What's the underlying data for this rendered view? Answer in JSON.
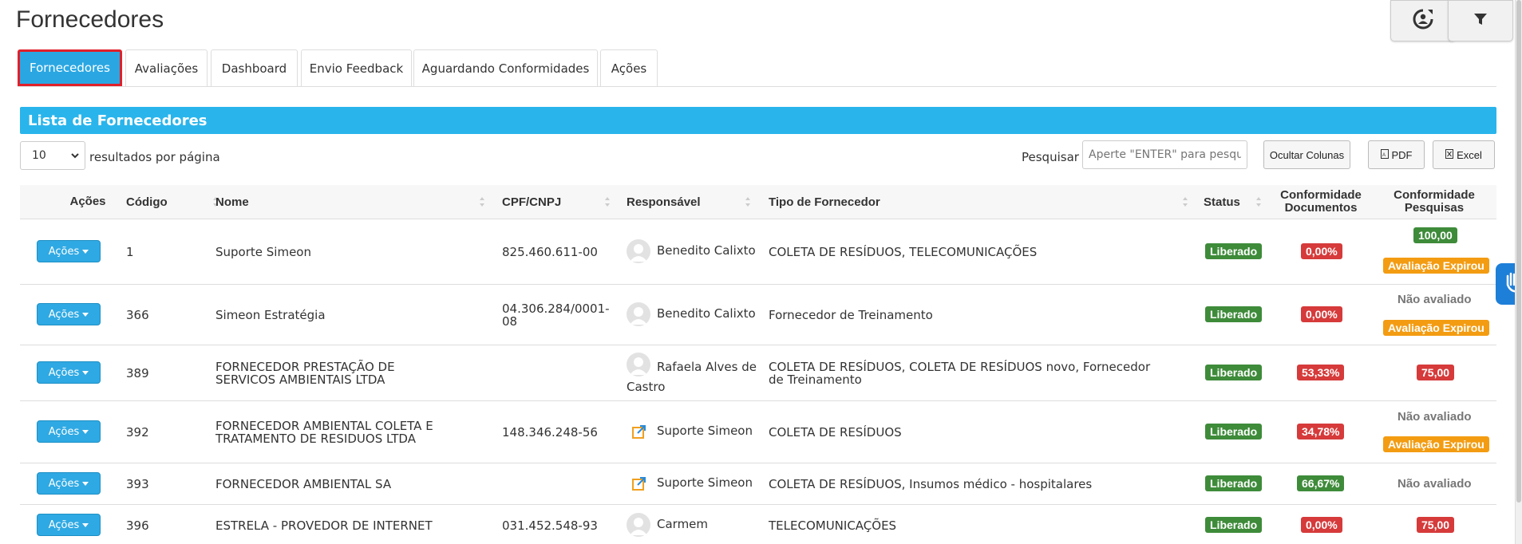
{
  "page": {
    "title": "Fornecedores"
  },
  "tabs": [
    {
      "label": "Fornecedores"
    },
    {
      "label": "Avaliações"
    },
    {
      "label": "Dashboard"
    },
    {
      "label": "Envio Feedback"
    },
    {
      "label": "Aguardando Conformidades"
    },
    {
      "label": "Ações"
    }
  ],
  "panel": {
    "title": "Lista de Fornecedores"
  },
  "controls": {
    "page_size": "10",
    "per_page_label": "resultados por página",
    "search_label": "Pesquisar",
    "search_placeholder": "Aperte \"ENTER\" para pesquisar",
    "hide_columns": "Ocultar Colunas",
    "pdf": "PDF",
    "excel": "Excel"
  },
  "table": {
    "headers": {
      "acoes": "Ações",
      "codigo": "Código",
      "nome": "Nome",
      "cpf": "CPF/CNPJ",
      "responsavel": "Responsável",
      "tipo": "Tipo de Fornecedor",
      "status": "Status",
      "conf_doc_1": "Conformidade",
      "conf_doc_2": "Documentos",
      "conf_pes_1": "Conformidade",
      "conf_pes_2": "Pesquisas"
    },
    "action_label": "Ações",
    "rows": [
      {
        "codigo": "1",
        "nome": "Suporte Simeon",
        "cpf": "825.460.611-00",
        "responsavel": "Benedito Calixto",
        "tipo": "COLETA DE RESÍDUOS, TELECOMUNICAÇÕES",
        "status": "Liberado",
        "conf_doc": "0,00%",
        "conf_pes_value": "100,00",
        "conf_pes_note": "Avaliação Expirou"
      },
      {
        "codigo": "366",
        "nome": "Simeon Estratégia",
        "cpf": "04.306.284/0001-08",
        "responsavel": "Benedito Calixto",
        "tipo": "Fornecedor de Treinamento",
        "status": "Liberado",
        "conf_doc": "0,00%",
        "conf_pes_text": "Não avaliado",
        "conf_pes_note": "Avaliação Expirou"
      },
      {
        "codigo": "389",
        "nome": "FORNECEDOR PRESTAÇÃO DE SERVICOS AMBIENTAIS LTDA",
        "cpf": "",
        "responsavel": "Rafaela Alves de Castro",
        "tipo": "COLETA DE RESÍDUOS, COLETA DE RESÍDUOS novo, Fornecedor de Treinamento",
        "status": "Liberado",
        "conf_doc": "53,33%",
        "conf_pes_value": "75,00"
      },
      {
        "codigo": "392",
        "nome": "FORNECEDOR AMBIENTAL COLETA E TRATAMENTO DE RESIDUOS LTDA",
        "cpf": "148.346.248-56",
        "responsavel": "Suporte Simeon",
        "tipo": "COLETA DE RESÍDUOS",
        "status": "Liberado",
        "conf_doc": "34,78%",
        "conf_pes_text": "Não avaliado",
        "conf_pes_note": "Avaliação Expirou"
      },
      {
        "codigo": "393",
        "nome": "FORNECEDOR AMBIENTAL SA",
        "cpf": "",
        "responsavel": "Suporte Simeon",
        "tipo": "COLETA DE RESÍDUOS, Insumos médico - hospitalares",
        "status": "Liberado",
        "conf_doc": "66,67%",
        "conf_pes_text": "Não avaliado"
      },
      {
        "codigo": "396",
        "nome": "ESTRELA - PROVEDOR DE INTERNET",
        "cpf": "031.452.548-93",
        "responsavel": "Carmem",
        "tipo": "TELECOMUNICAÇÕES",
        "status": "Liberado",
        "conf_doc": "0,00%",
        "conf_pes_value": "75,00"
      }
    ]
  },
  "icons": {
    "refresh": "user-sync-icon",
    "filter": "filter-icon",
    "accessibility": "sign-language-icon"
  },
  "colors": {
    "tab_active": "#2aa7e3",
    "tab_outline": "#e0202a",
    "panel_header": "#29b5ec",
    "status_green": "#3e8b3a",
    "badge_red": "#d63a3a",
    "badge_orange": "#f39c12"
  }
}
